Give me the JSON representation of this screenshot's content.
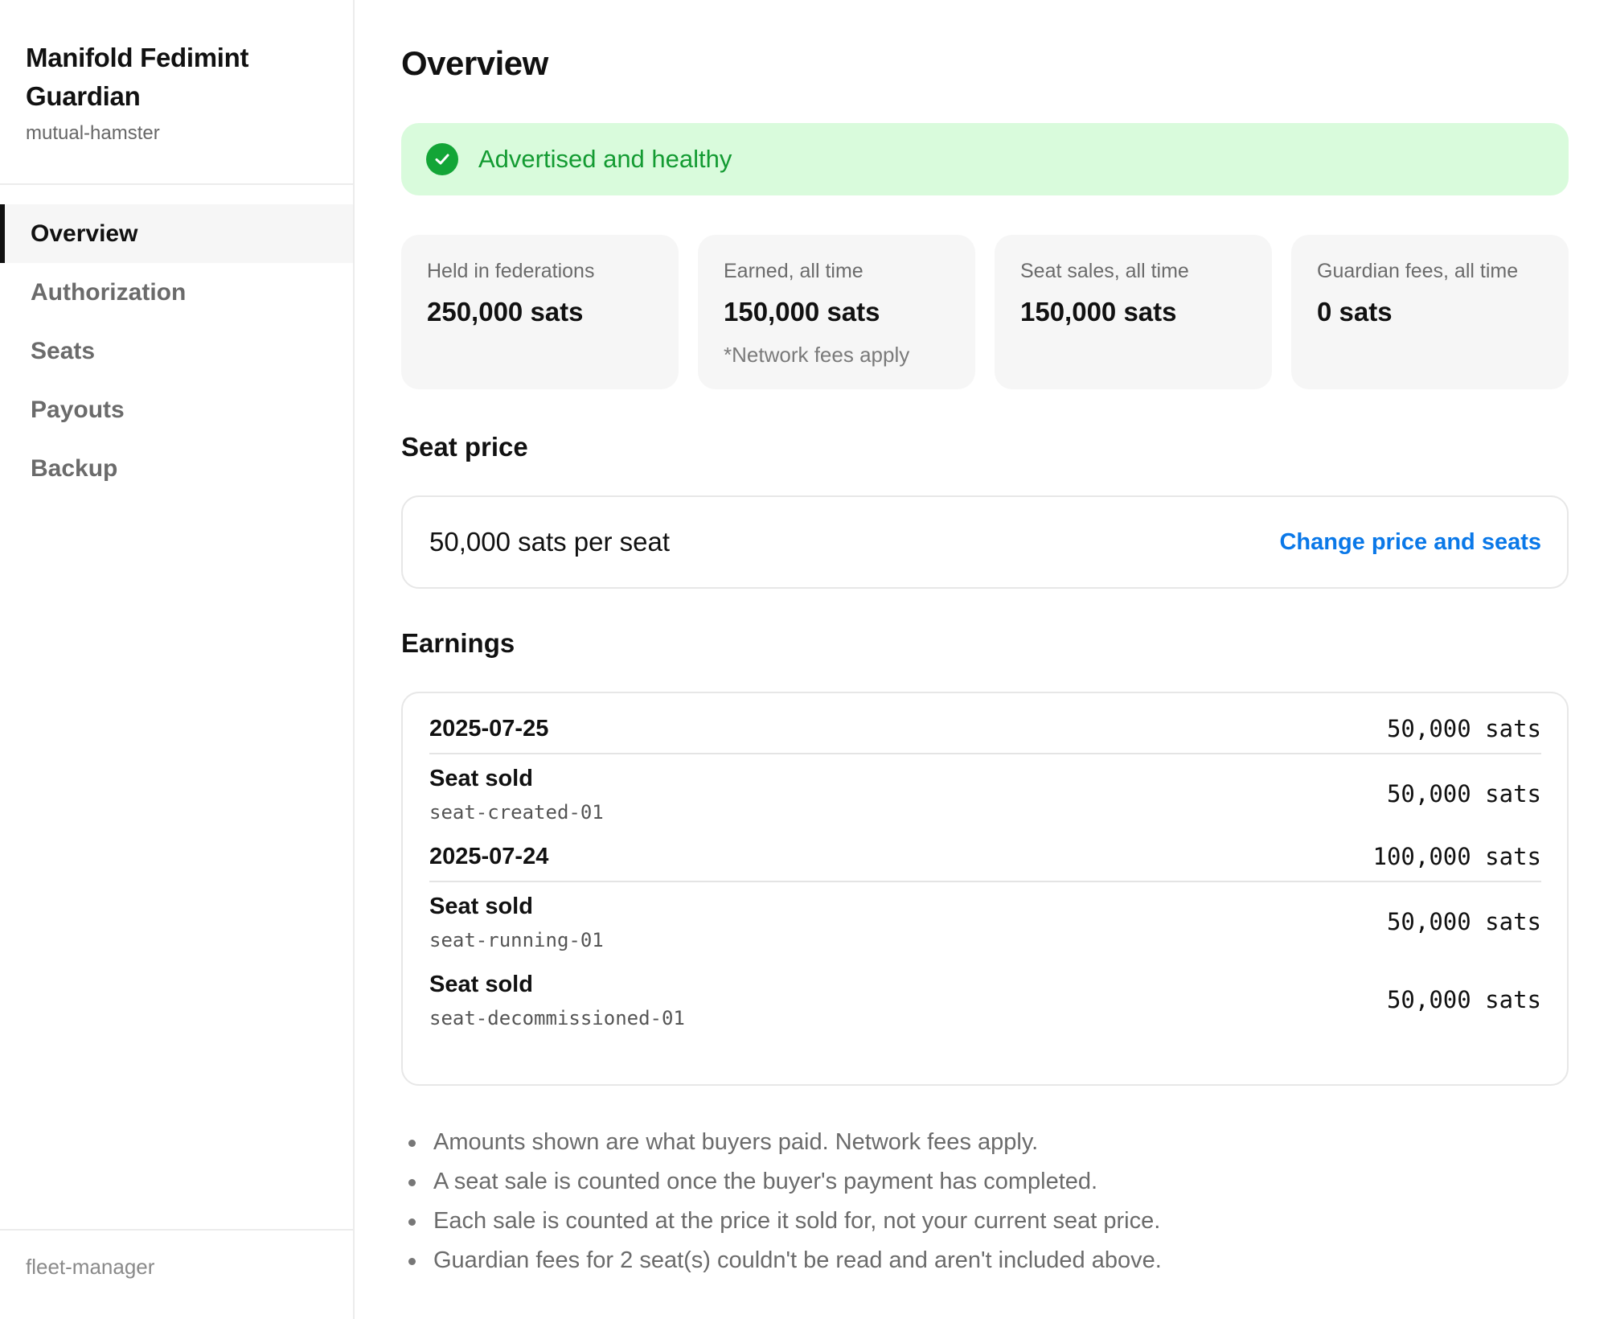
{
  "sidebar": {
    "title": "Manifold Fedimint Guardian",
    "subtitle": "mutual-hamster",
    "items": [
      {
        "label": "Overview"
      },
      {
        "label": "Authorization"
      },
      {
        "label": "Seats"
      },
      {
        "label": "Payouts"
      },
      {
        "label": "Backup"
      }
    ],
    "active_item": "Overview",
    "footer": "fleet-manager"
  },
  "main": {
    "title": "Overview",
    "status": {
      "text": "Advertised and healthy",
      "icon": "check-circle-icon",
      "color": "#13a537"
    },
    "stats": [
      {
        "label": "Held in federations",
        "value": "250,000 sats"
      },
      {
        "label": "Earned, all time",
        "value": "150,000 sats",
        "note": "*Network fees apply"
      },
      {
        "label": "Seat sales, all time",
        "value": "150,000 sats"
      },
      {
        "label": "Guardian fees, all time",
        "value": "0 sats"
      }
    ],
    "seat_price": {
      "heading": "Seat price",
      "text": "50,000 sats per seat",
      "link": "Change price and seats"
    },
    "earnings": {
      "heading": "Earnings",
      "days": [
        {
          "date": "2025-07-25",
          "total": "50,000 sats",
          "sales": [
            {
              "title": "Seat sold",
              "id": "seat-created-01",
              "amount": "50,000 sats"
            }
          ]
        },
        {
          "date": "2025-07-24",
          "total": "100,000 sats",
          "sales": [
            {
              "title": "Seat sold",
              "id": "seat-running-01",
              "amount": "50,000 sats"
            },
            {
              "title": "Seat sold",
              "id": "seat-decommissioned-01",
              "amount": "50,000 sats"
            }
          ]
        }
      ]
    },
    "notes": [
      "Amounts shown are what buyers paid. Network fees apply.",
      "A seat sale is counted once the buyer's payment has completed.",
      "Each sale is counted at the price it sold for, not your current seat price.",
      "Guardian fees for 2 seat(s) couldn't be read and aren't included above."
    ]
  },
  "colors": {
    "accent_link": "#0a78e8",
    "success_bg": "#d9fbdc",
    "success_text": "#139b32"
  }
}
